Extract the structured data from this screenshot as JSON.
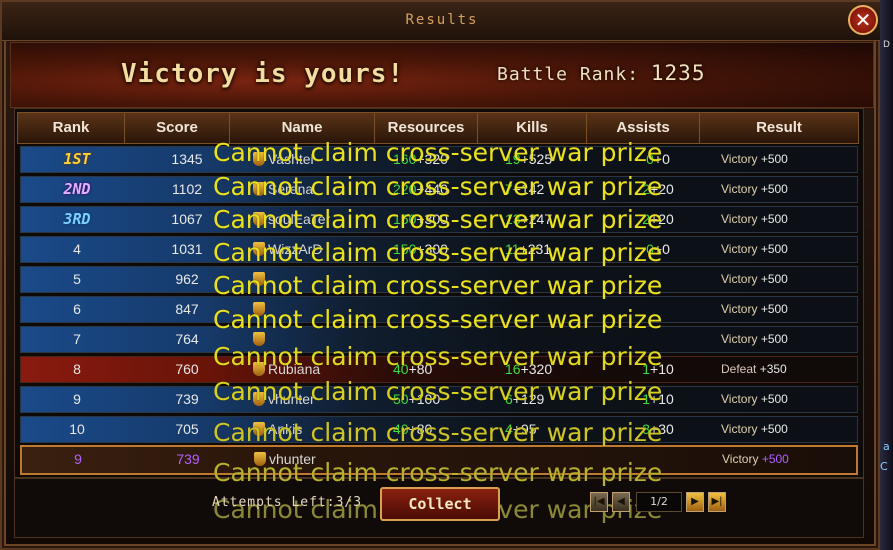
{
  "window": {
    "title": "Results",
    "close_glyph": "✕"
  },
  "banner": {
    "headline": "Victory is yours!",
    "battle_rank_label": "Battle Rank:",
    "battle_rank_value": "1235"
  },
  "table": {
    "columns": [
      "Rank",
      "Score",
      "Name",
      "Resources",
      "Kills",
      "Assists",
      "Result"
    ],
    "rows": [
      {
        "rank": "1ST",
        "score": "1345",
        "name": "Vashtel",
        "res_a": "160",
        "res_b": "+320",
        "kills_a": "19",
        "kills_b": "+525",
        "assist_a": "0",
        "assist_b": "+0",
        "result": "Victory",
        "bonus": "+500"
      },
      {
        "rank": "2ND",
        "score": "1102",
        "name": "Serena",
        "res_a": "220",
        "res_b": "+440",
        "kills_a": "7",
        "kills_b": "+142",
        "assist_a": "2",
        "assist_b": "+20",
        "result": "Victory",
        "bonus": "+500"
      },
      {
        "rank": "3RD",
        "score": "1067",
        "name": "soulEaTer",
        "res_a": "150",
        "res_b": "+300",
        "kills_a": "13",
        "kills_b": "+247",
        "assist_a": "2",
        "assist_b": "+20",
        "result": "Victory",
        "bonus": "+500"
      },
      {
        "rank": "4",
        "score": "1031",
        "name": "WizzArD",
        "res_a": "150",
        "res_b": "+300",
        "kills_a": "11",
        "kills_b": "+231",
        "assist_a": "0",
        "assist_b": "+0",
        "result": "Victory",
        "bonus": "+500"
      },
      {
        "rank": "5",
        "score": "962",
        "name": "",
        "res_a": "",
        "res_b": "",
        "kills_a": "",
        "kills_b": "",
        "assist_a": "",
        "assist_b": "",
        "result": "Victory",
        "bonus": "+500"
      },
      {
        "rank": "6",
        "score": "847",
        "name": "",
        "res_a": "",
        "res_b": "",
        "kills_a": "",
        "kills_b": "",
        "assist_a": "",
        "assist_b": "",
        "result": "Victory",
        "bonus": "+500"
      },
      {
        "rank": "7",
        "score": "764",
        "name": "",
        "res_a": "",
        "res_b": "",
        "kills_a": "",
        "kills_b": "",
        "assist_a": "",
        "assist_b": "",
        "result": "Victory",
        "bonus": "+500"
      },
      {
        "rank": "8",
        "score": "760",
        "name": "Rubiana",
        "res_a": "40",
        "res_b": "+80",
        "kills_a": "16",
        "kills_b": "+320",
        "assist_a": "1",
        "assist_b": "+10",
        "result": "Defeat",
        "bonus": "+350"
      },
      {
        "rank": "9",
        "score": "739",
        "name": "vhunter",
        "res_a": "50",
        "res_b": "+100",
        "kills_a": "6",
        "kills_b": "+129",
        "assist_a": "1",
        "assist_b": "+10",
        "result": "Victory",
        "bonus": "+500"
      },
      {
        "rank": "10",
        "score": "705",
        "name": "Ankis",
        "res_a": "40",
        "res_b": "+80",
        "kills_a": "4",
        "kills_b": "+95",
        "assist_a": "3",
        "assist_b": "+30",
        "result": "Victory",
        "bonus": "+500"
      }
    ],
    "my_row": {
      "rank": "9",
      "score": "739",
      "name": "vhunter",
      "res_a": "",
      "res_b": "",
      "kills_a": "",
      "kills_b": "",
      "assist_a": "",
      "assist_b": "",
      "result": "Victory",
      "bonus": "+500"
    }
  },
  "overlay_message": "Cannot claim cross-server war prize",
  "footer": {
    "attempts_label": "Attempts Left:3/3",
    "collect_label": "Collect",
    "page": "1/2",
    "first_glyph": "|◀",
    "prev_glyph": "◀",
    "next_glyph": "▶",
    "last_glyph": "▶|"
  },
  "colors": {
    "gain_green": "#3ddb3d",
    "overlay_yellow": "#e8e020",
    "highlight_purple": "#b060ff",
    "victory_blue": "#1a4a8a",
    "defeat_red": "#8a1a10"
  }
}
